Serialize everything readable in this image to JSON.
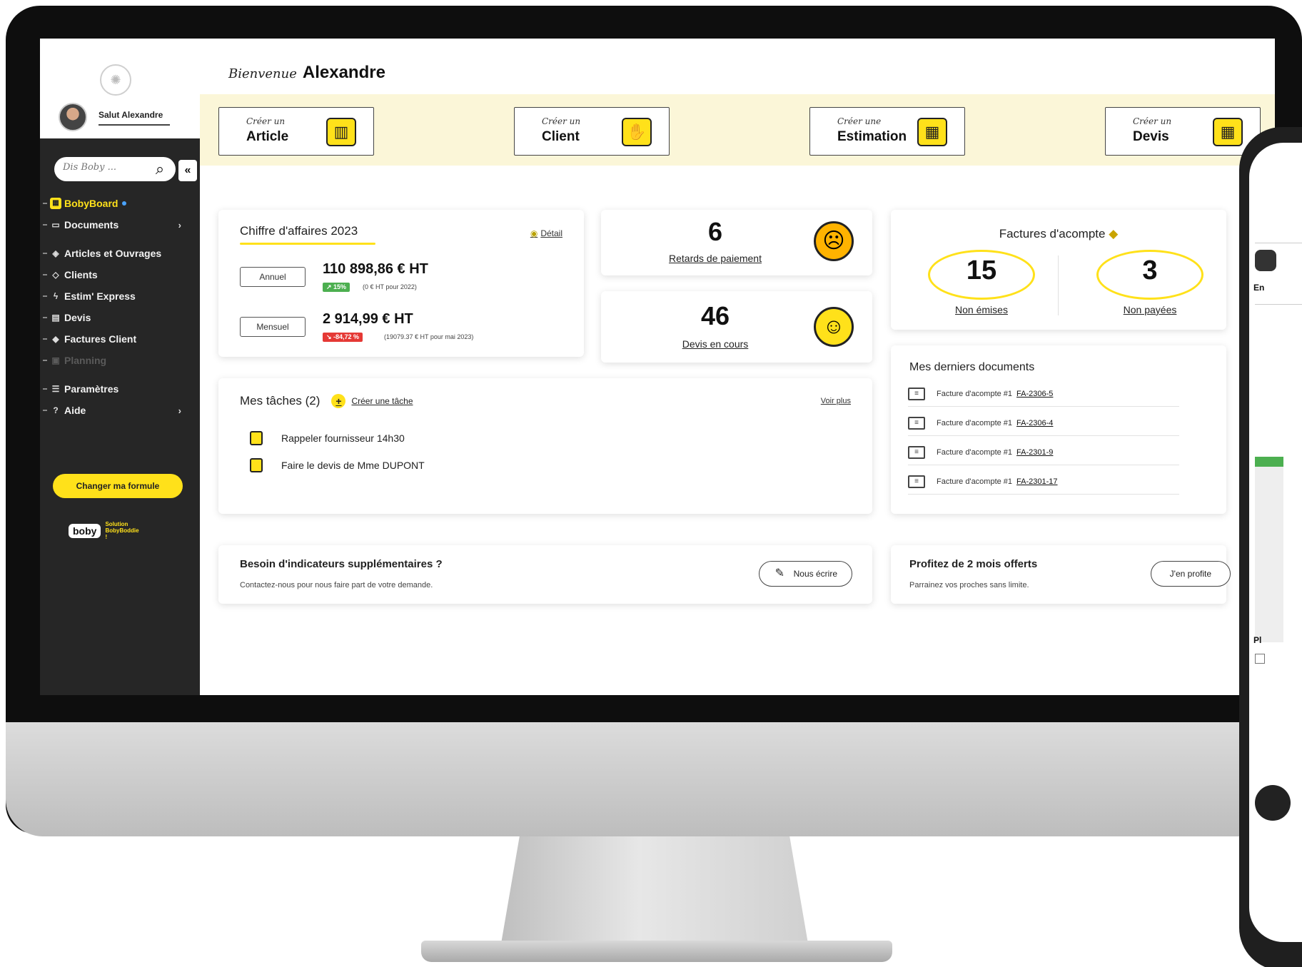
{
  "sidebar": {
    "greeting": "Salut Alexandre",
    "search_placeholder": "Dis Boby ...",
    "collapse_label": "«",
    "items": [
      {
        "label": "BobyBoard",
        "icon": "grid-icon"
      },
      {
        "label": "Documents",
        "icon": "folder-icon"
      },
      {
        "label": "Articles et Ouvrages",
        "icon": "tag-icon"
      },
      {
        "label": "Clients",
        "icon": "handshake-icon"
      },
      {
        "label": "Estim' Express",
        "icon": "bolt-icon"
      },
      {
        "label": "Devis",
        "icon": "document-icon"
      },
      {
        "label": "Factures Client",
        "icon": "money-icon"
      },
      {
        "label": "Planning",
        "icon": "calendar-icon"
      },
      {
        "label": "Paramètres",
        "icon": "sliders-icon"
      },
      {
        "label": "Aide",
        "icon": "help-icon"
      }
    ],
    "upgrade_label": "Changer ma formule",
    "brand_word": "boby",
    "brand_tagline": "Solution BobyBoddie !"
  },
  "header": {
    "welcome_script": "Bienvenue",
    "welcome_name": "Alexandre"
  },
  "quick_actions": [
    {
      "pre": "Créer un",
      "label": "Article",
      "icon": "brick-icon"
    },
    {
      "pre": "Créer un",
      "label": "Client",
      "icon": "handshake-icon"
    },
    {
      "pre": "Créer une",
      "label": "Estimation",
      "icon": "calculator-icon"
    },
    {
      "pre": "Créer un",
      "label": "Devis",
      "icon": "calculator-icon"
    }
  ],
  "revenue": {
    "title": "Chiffre d'affaires 2023",
    "detail_label": "Détail",
    "annual_label": "Annuel",
    "annual_amount": "110 898,86 € HT",
    "annual_badge": "↗ 15%",
    "annual_compare": "(0 € HT pour 2022)",
    "monthly_label": "Mensuel",
    "monthly_amount": "2 914,99 € HT",
    "monthly_badge": "↘ -84,72 %",
    "monthly_compare": "(19079.37 € HT pour mai 2023)"
  },
  "late_payments": {
    "count": "6",
    "label": "Retards de paiement"
  },
  "quotes": {
    "count": "46",
    "label": "Devis en cours"
  },
  "deposits": {
    "title": "Factures d'acompte",
    "not_issued_count": "15",
    "not_issued_label": "Non émises",
    "unpaid_count": "3",
    "unpaid_label": "Non payées"
  },
  "tasks": {
    "title": "Mes tâches (2)",
    "create_label": "Créer une tâche",
    "more_label": "Voir plus",
    "items": [
      "Rappeler fournisseur 14h30",
      "Faire le devis de Mme DUPONT"
    ]
  },
  "documents": {
    "title": "Mes derniers documents",
    "items": [
      {
        "label": "Facture d'acompte #1",
        "ref": "FA-2306-5"
      },
      {
        "label": "Facture d'acompte #1",
        "ref": "FA-2306-4"
      },
      {
        "label": "Facture d'acompte #1",
        "ref": "FA-2301-9"
      },
      {
        "label": "Facture d'acompte #1",
        "ref": "FA-2301-17"
      }
    ]
  },
  "indicators": {
    "title": "Besoin d'indicateurs supplémentaires ?",
    "subtitle": "Contactez-nous pour nous faire part de votre demande.",
    "button": "Nous écrire"
  },
  "referral": {
    "title": "Profitez de 2 mois offerts",
    "subtitle": "Parrainez vos proches sans limite.",
    "button": "J'en profite"
  },
  "phone": {
    "heading": "En",
    "section": "Pl"
  }
}
